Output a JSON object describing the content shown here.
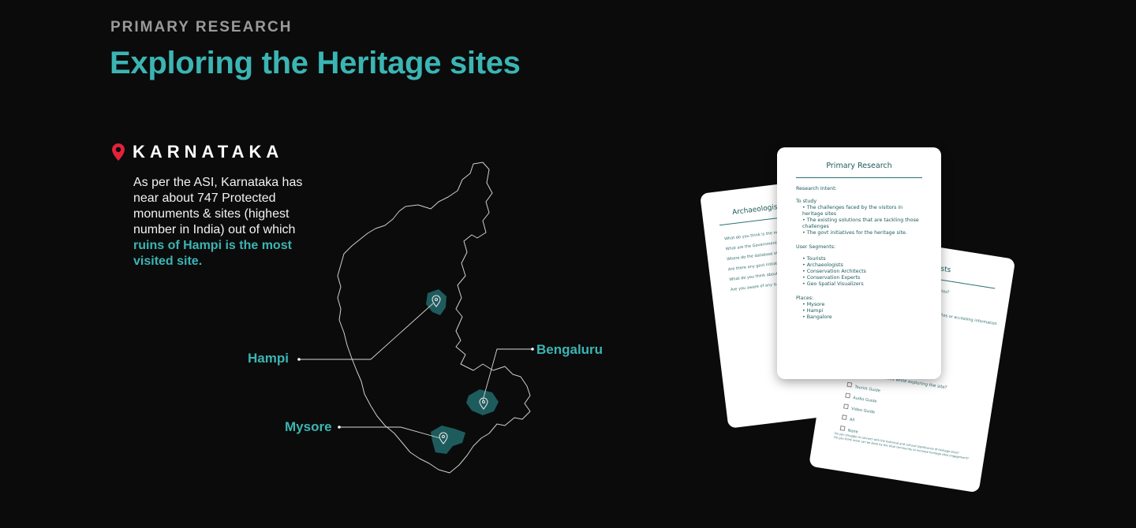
{
  "header": {
    "eyebrow": "PRIMARY RESEARCH",
    "title": "Exploring the Heritage sites"
  },
  "state": {
    "name": "KARNATAKA",
    "desc_plain": "As per the ASI, Karnataka has near about 747 Protected monuments & sites (highest number in India) out of which ",
    "desc_highlight": "ruins of Hampi is the most visited site."
  },
  "cities": {
    "hampi": "Hampi",
    "bengaluru": "Bengaluru",
    "mysore": "Mysore"
  },
  "colors": {
    "accent": "#3bb5b3",
    "pin": "#e0233b",
    "region": "#1e5b5d"
  },
  "card_main": {
    "title": "Primary Research",
    "intent_label": "Research Intent:",
    "study_label": "To study",
    "study": [
      "The challenges faced by the visitors in heritage sites",
      "The existing solutions that are tackling those challenges",
      "The govt initiatives for the heritage site."
    ],
    "segments_label": "User Segments:",
    "segments": [
      "Tourists",
      "Archaeologists",
      "Conservation Architects",
      "Conservation Experts",
      "Geo Spatial Visualizers"
    ],
    "places_label": "Places:",
    "places": [
      "Mysore",
      "Hampi",
      "Bangalore"
    ]
  },
  "card_left": {
    "title": "Archaeologists/ C",
    "questions": [
      "What do you think is the most c existing heritage sites in India?",
      "What are the Government Pri heritage sites?",
      "Where do the database of ruine",
      "Are there any govt initiatives",
      "What do you think about dig",
      "Are you aware of any such s"
    ]
  },
  "card_right": {
    "title": "rists",
    "q1": "ites?",
    "q2": "heritage sites or accessing information ?",
    "q3": "Did you take assistance while exploring the site?",
    "options": [
      "Tourist Guide",
      "Audio Guide",
      "Video Guide",
      "All",
      "None"
    ],
    "foot1": "Do you struggle to connect with the historical and cultural significance of heritage sites?",
    "foot2": "Do you think more can be done by the local community to increase heritage sites engagement?"
  }
}
